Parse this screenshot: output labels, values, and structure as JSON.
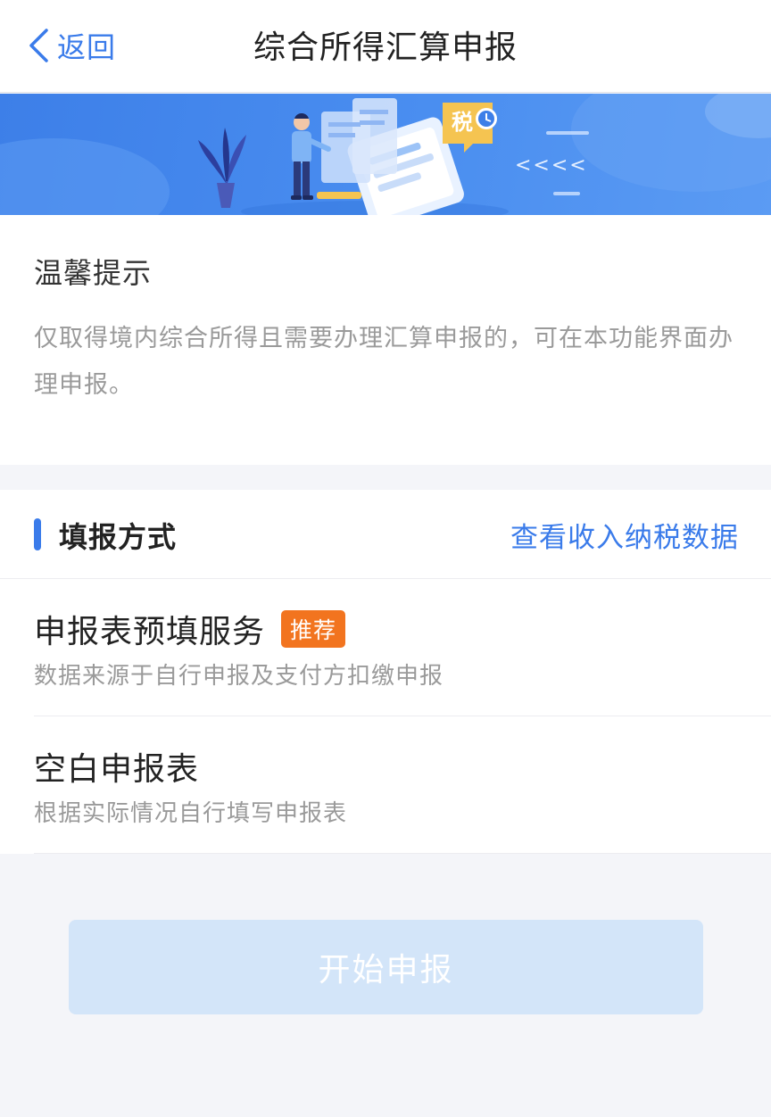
{
  "header": {
    "back_label": "返回",
    "title": "综合所得汇算申报"
  },
  "banner": {
    "tax_badge_text": "税",
    "arrows_text": "<<<<"
  },
  "tips": {
    "title": "温馨提示",
    "body": "仅取得境内综合所得且需要办理汇算申报的，可在本功能界面办理申报。"
  },
  "method": {
    "title": "填报方式",
    "link_label": "查看收入纳税数据",
    "options": [
      {
        "title": "申报表预填服务",
        "badge": "推荐",
        "description": "数据来源于自行申报及支付方扣缴申报"
      },
      {
        "title": "空白申报表",
        "description": "根据实际情况自行填写申报表"
      }
    ]
  },
  "start_button": {
    "label": "开始申报",
    "state": "disabled"
  },
  "colors": {
    "accent": "#3a7bea",
    "badge": "#f2741f",
    "button_disabled": "#d3e5f9"
  }
}
